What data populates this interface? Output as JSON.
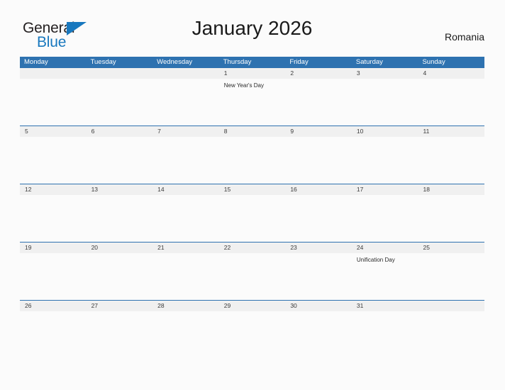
{
  "brand": {
    "name_part1": "General",
    "name_part2": "Blue",
    "triangle_icon": "triangle-icon"
  },
  "header": {
    "title": "January 2026",
    "region": "Romania"
  },
  "colors": {
    "header_blue": "#2e72b0",
    "band_gray": "#f0f0f0",
    "brand_blue": "#1878be",
    "page_background": "#fbfbfb",
    "text": "#222222"
  },
  "calendar": {
    "weekdays": [
      "Monday",
      "Tuesday",
      "Wednesday",
      "Thursday",
      "Friday",
      "Saturday",
      "Sunday"
    ],
    "weeks": [
      {
        "days": [
          {
            "date": "",
            "event": ""
          },
          {
            "date": "",
            "event": ""
          },
          {
            "date": "",
            "event": ""
          },
          {
            "date": "1",
            "event": "New Year's Day"
          },
          {
            "date": "2",
            "event": ""
          },
          {
            "date": "3",
            "event": ""
          },
          {
            "date": "4",
            "event": ""
          }
        ]
      },
      {
        "days": [
          {
            "date": "5",
            "event": ""
          },
          {
            "date": "6",
            "event": ""
          },
          {
            "date": "7",
            "event": ""
          },
          {
            "date": "8",
            "event": ""
          },
          {
            "date": "9",
            "event": ""
          },
          {
            "date": "10",
            "event": ""
          },
          {
            "date": "11",
            "event": ""
          }
        ]
      },
      {
        "days": [
          {
            "date": "12",
            "event": ""
          },
          {
            "date": "13",
            "event": ""
          },
          {
            "date": "14",
            "event": ""
          },
          {
            "date": "15",
            "event": ""
          },
          {
            "date": "16",
            "event": ""
          },
          {
            "date": "17",
            "event": ""
          },
          {
            "date": "18",
            "event": ""
          }
        ]
      },
      {
        "days": [
          {
            "date": "19",
            "event": ""
          },
          {
            "date": "20",
            "event": ""
          },
          {
            "date": "21",
            "event": ""
          },
          {
            "date": "22",
            "event": ""
          },
          {
            "date": "23",
            "event": ""
          },
          {
            "date": "24",
            "event": "Unification Day"
          },
          {
            "date": "25",
            "event": ""
          }
        ]
      },
      {
        "days": [
          {
            "date": "26",
            "event": ""
          },
          {
            "date": "27",
            "event": ""
          },
          {
            "date": "28",
            "event": ""
          },
          {
            "date": "29",
            "event": ""
          },
          {
            "date": "30",
            "event": ""
          },
          {
            "date": "31",
            "event": ""
          },
          {
            "date": "",
            "event": ""
          }
        ]
      }
    ]
  }
}
